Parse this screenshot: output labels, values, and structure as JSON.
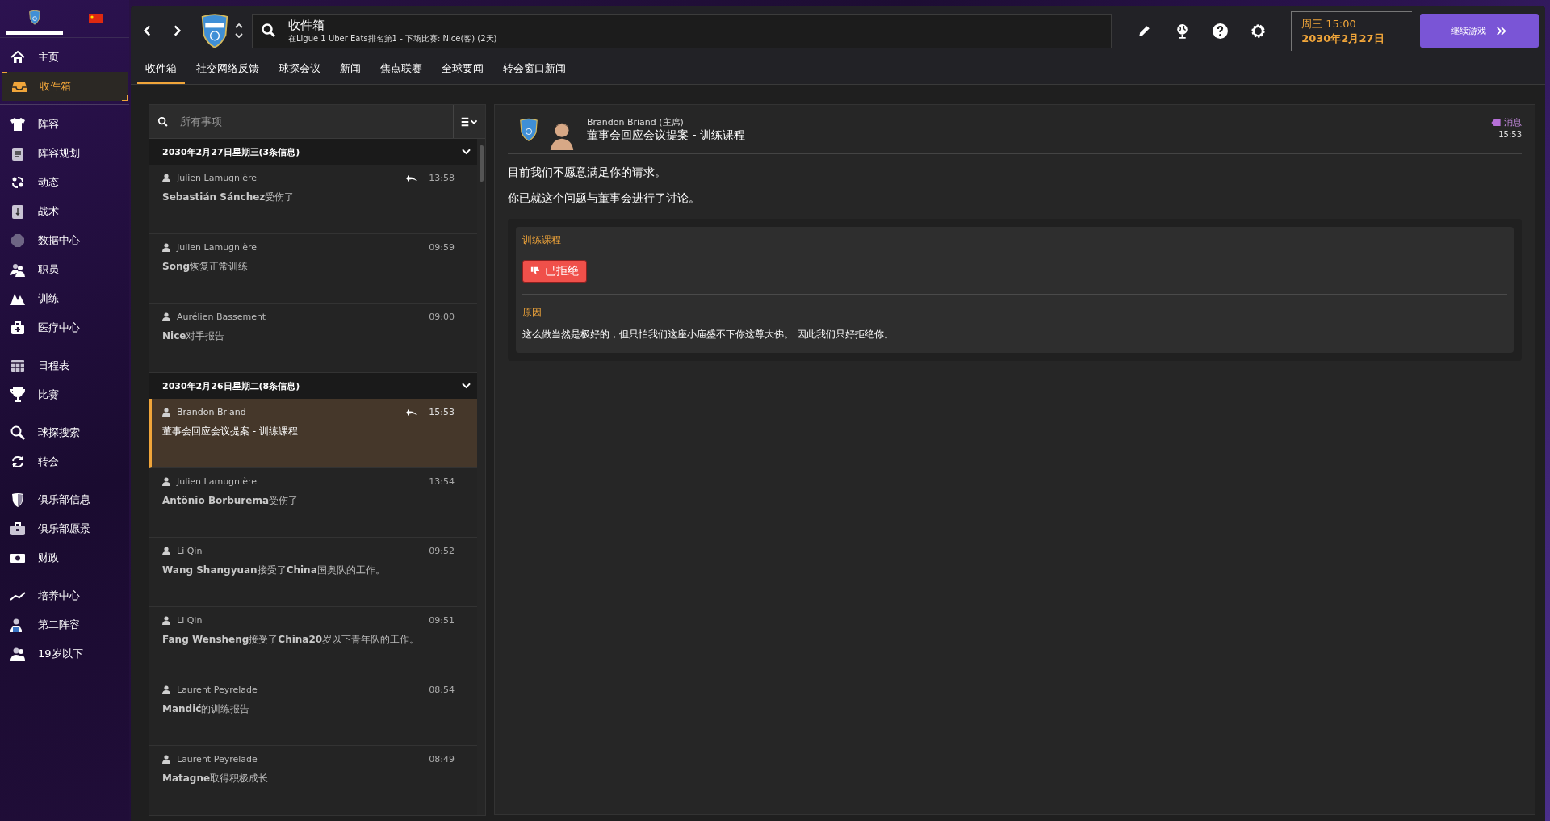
{
  "sidebar": {
    "groups": [
      {
        "items": [
          {
            "label": "主页",
            "selected": false
          },
          {
            "label": "收件箱",
            "selected": true
          }
        ]
      },
      {
        "items": [
          {
            "label": "阵容",
            "selected": false
          },
          {
            "label": "阵容规划",
            "selected": false
          },
          {
            "label": "动态",
            "selected": false
          },
          {
            "label": "战术",
            "selected": false
          },
          {
            "label": "数据中心",
            "selected": false
          },
          {
            "label": "职员",
            "selected": false
          },
          {
            "label": "训练",
            "selected": false
          },
          {
            "label": "医疗中心",
            "selected": false
          }
        ]
      },
      {
        "items": [
          {
            "label": "日程表",
            "selected": false
          },
          {
            "label": "比赛",
            "selected": false
          }
        ]
      },
      {
        "items": [
          {
            "label": "球探搜索",
            "selected": false
          },
          {
            "label": "转会",
            "selected": false
          }
        ]
      },
      {
        "items": [
          {
            "label": "俱乐部信息",
            "selected": false
          },
          {
            "label": "俱乐部愿景",
            "selected": false
          },
          {
            "label": "财政",
            "selected": false
          }
        ]
      },
      {
        "items": [
          {
            "label": "培养中心",
            "selected": false
          },
          {
            "label": "第二阵容",
            "selected": false
          },
          {
            "label": "19岁以下",
            "selected": false
          }
        ]
      }
    ]
  },
  "header": {
    "title": "收件箱",
    "subtitle": "在Ligue 1 Uber Eats排名第1 - 下场比赛: Nice(客) (2天)",
    "weekday_time": "周三 15:00",
    "date": "2030年2月27日",
    "continue_button": "继续游戏"
  },
  "tabs": [
    {
      "label": "收件箱",
      "selected": true
    },
    {
      "label": "社交网络反馈",
      "selected": false
    },
    {
      "label": "球探会议",
      "selected": false
    },
    {
      "label": "新闻",
      "selected": false
    },
    {
      "label": "焦点联赛",
      "selected": false
    },
    {
      "label": "全球要闻",
      "selected": false
    },
    {
      "label": "转会窗口新闻",
      "selected": false
    }
  ],
  "inbox": {
    "search": {
      "placeholder": "所有事项"
    },
    "groups": [
      {
        "title": "2030年2月27日星期三(3条信息)",
        "expanded": true,
        "messages": [
          {
            "sender": "Julien Lamugnière",
            "time": "13:58",
            "subject": "**Sebastián Sánchez**受伤了",
            "replied": true,
            "selected": false
          },
          {
            "sender": "Julien Lamugnière",
            "time": "09:59",
            "subject": "**Song**恢复正常训练",
            "replied": false,
            "selected": false
          },
          {
            "sender": "Aurélien Bassement",
            "time": "09:00",
            "subject": "**Nice**对手报告",
            "replied": false,
            "selected": false
          }
        ]
      },
      {
        "title": "2030年2月26日星期二(8条信息)",
        "expanded": true,
        "messages": [
          {
            "sender": "Brandon Briand",
            "time": "15:53",
            "subject": "董事会回应会议提案 - 训练课程",
            "replied": true,
            "selected": true
          },
          {
            "sender": "Julien Lamugnière",
            "time": "13:54",
            "subject": "**Antônio Borburema**受伤了",
            "replied": false,
            "selected": false
          },
          {
            "sender": "Li Qin",
            "time": "09:52",
            "subject": "**Wang Shangyuan**接受了**China**国奥队的工作。",
            "replied": false,
            "selected": false
          },
          {
            "sender": "Li Qin",
            "time": "09:51",
            "subject": "**Fang Wensheng**接受了**China20**岁以下青年队的工作。",
            "replied": false,
            "selected": false
          },
          {
            "sender": "Laurent Peyrelade",
            "time": "08:54",
            "subject": "**Mandić**的训练报告",
            "replied": false,
            "selected": false
          },
          {
            "sender": "Laurent Peyrelade",
            "time": "08:49",
            "subject": "**Matagne**取得积极成长",
            "replied": false,
            "selected": false
          }
        ]
      }
    ]
  },
  "detail": {
    "sender": "Brandon Briand (主席)",
    "subject": "董事会回应会议提案 - 训练课程",
    "tag": "消息",
    "time": "15:53",
    "paragraphs": [
      "目前我们不愿意满足你的请求。",
      "你已就这个问题与董事会进行了讨论。"
    ],
    "card": {
      "title": "训练课程",
      "status": "已拒绝",
      "kind": "rejected",
      "reason_label": "原因",
      "reason": "这么做当然是极好的，但只怕我们这座小庙盛不下你这尊大佛。 因此我们只好拒绝你。"
    }
  }
}
